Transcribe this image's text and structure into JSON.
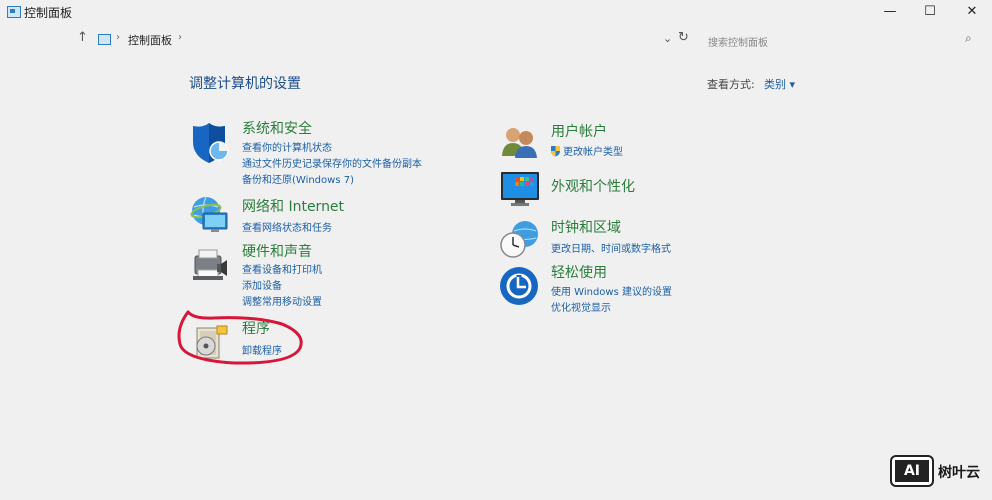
{
  "window": {
    "title": "控制面板",
    "minimize_glyph": "—",
    "maximize_glyph": "☐",
    "close_glyph": "✕"
  },
  "nav": {
    "up_glyph": "↑",
    "sep_glyph": "›",
    "breadcrumb": "控制面板",
    "dropdown_glyph": "⌄",
    "refresh_glyph": "↻",
    "search_placeholder": "搜索控制面板",
    "search_glyph": "⌕"
  },
  "main": {
    "heading": "调整计算机的设置",
    "view_by_label": "查看方式:",
    "view_by_value": "类别 ▾"
  },
  "categories": {
    "system_security": {
      "title": "系统和安全",
      "links": [
        "查看你的计算机状态",
        "通过文件历史记录保存你的文件备份副本",
        "备份和还原(Windows 7)"
      ]
    },
    "network": {
      "title": "网络和 Internet",
      "links": [
        "查看网络状态和任务"
      ]
    },
    "hardware": {
      "title": "硬件和声音",
      "links": [
        "查看设备和打印机",
        "添加设备",
        "调整常用移动设置"
      ]
    },
    "programs": {
      "title": "程序",
      "links": [
        "卸载程序"
      ]
    },
    "user_accounts": {
      "title": "用户帐户",
      "links": [
        "更改帐户类型"
      ]
    },
    "appearance": {
      "title": "外观和个性化",
      "links": []
    },
    "clock_region": {
      "title": "时钟和区域",
      "links": [
        "更改日期、时间或数字格式"
      ]
    },
    "ease": {
      "title": "轻松使用",
      "links": [
        "使用 Windows 建议的设置",
        "优化视觉显示"
      ]
    }
  },
  "watermark": {
    "logo": "AI",
    "text": "树叶云"
  },
  "colors": {
    "background": "#f0f0f0",
    "category_title": "#2a7d3c",
    "link": "#1b5fa8",
    "annotation": "#d6163a"
  }
}
